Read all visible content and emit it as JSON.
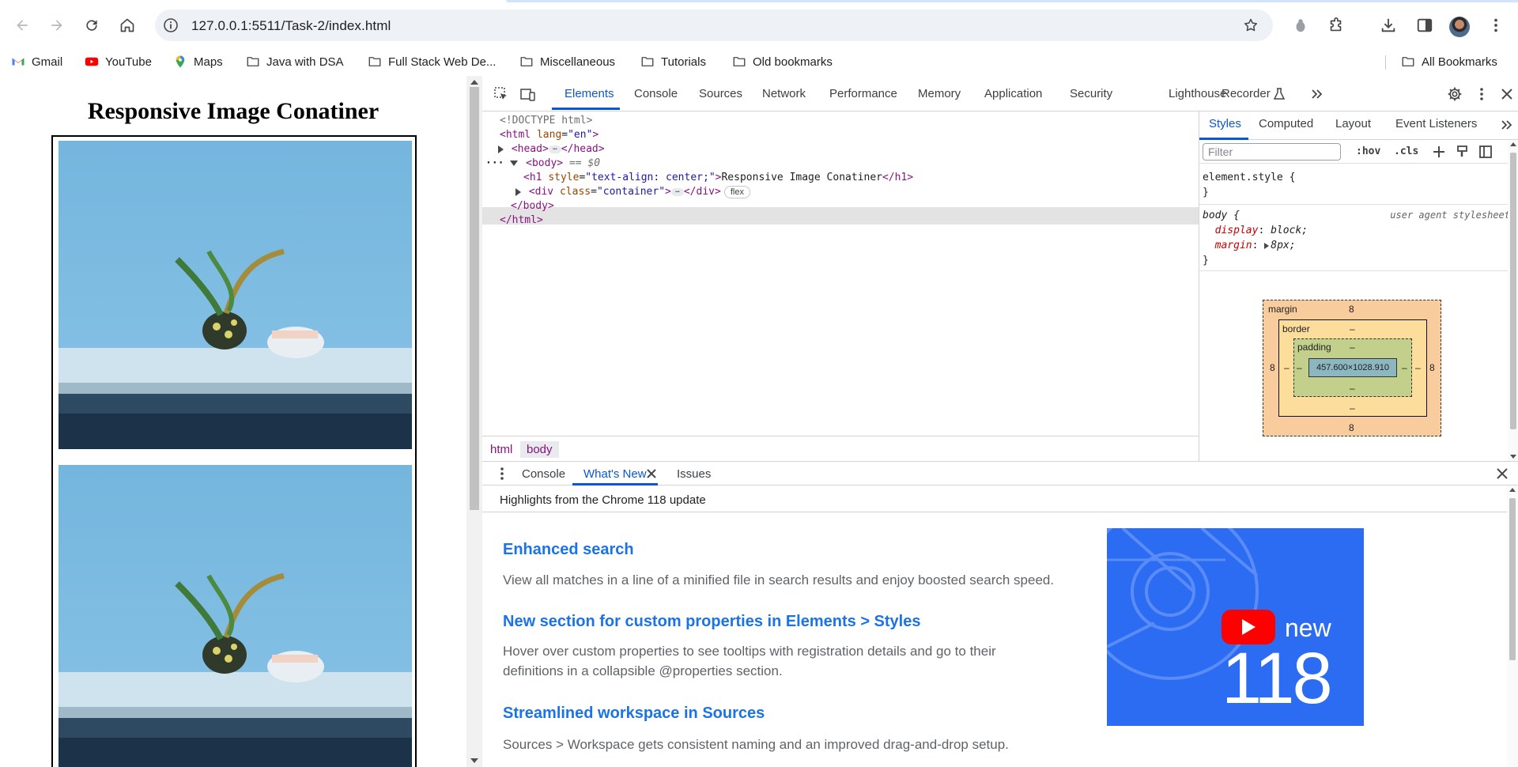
{
  "browser": {
    "url": "127.0.0.1:5511/Task-2/index.html",
    "bookmarks": [
      {
        "label": "Gmail",
        "icon": "gmail-icon"
      },
      {
        "label": "YouTube",
        "icon": "youtube-icon"
      },
      {
        "label": "Maps",
        "icon": "maps-icon"
      },
      {
        "label": "Java with DSA",
        "icon": "folder-icon"
      },
      {
        "label": "Full Stack Web De...",
        "icon": "folder-icon"
      },
      {
        "label": "Miscellaneous",
        "icon": "folder-icon"
      },
      {
        "label": "Tutorials",
        "icon": "folder-icon"
      },
      {
        "label": "Old bookmarks",
        "icon": "folder-icon"
      }
    ],
    "all_bookmarks": "All Bookmarks"
  },
  "page": {
    "heading": "Responsive Image Conatiner"
  },
  "devtools": {
    "tabs": [
      "Elements",
      "Console",
      "Sources",
      "Network",
      "Performance",
      "Memory",
      "Application",
      "Security",
      "Lighthouse",
      "Recorder"
    ],
    "active_tab": "Elements",
    "dom": {
      "doctype": "<!DOCTYPE html>",
      "html_open_tag": "<html",
      "html_attr": "lang",
      "html_val": "\"en\"",
      "head_open": "<head>",
      "head_close": "</head>",
      "body_open": "<body>",
      "body_marker": "== $0",
      "h1_open": "<h1",
      "h1_attr": "style",
      "h1_val": "\"text-align: center;\"",
      "h1_text": "Responsive Image Conatiner",
      "h1_close": "</h1>",
      "div_open": "<div",
      "div_attr": "class",
      "div_val": "\"container\"",
      "div_close": "</div>",
      "flex_badge": "flex",
      "body_close": "</body>",
      "html_close": "</html>"
    },
    "breadcrumbs": [
      "html",
      "body"
    ],
    "styles": {
      "tabs": [
        "Styles",
        "Computed",
        "Layout",
        "Event Listeners"
      ],
      "filter_placeholder": "Filter",
      "hov": ":hov",
      "cls": ".cls",
      "element_style": "element.style {",
      "close_brace": "}",
      "body_selector": "body {",
      "ua_label": "user agent stylesheet",
      "display_prop": "display",
      "display_val": "block;",
      "margin_prop": "margin",
      "margin_val": "8px;"
    },
    "box_model": {
      "margin_label": "margin",
      "border_label": "border",
      "padding_label": "padding",
      "margin": "8",
      "dash": "–",
      "content": "457.600×1028.910"
    },
    "drawer": {
      "tabs": [
        "Console",
        "What's New",
        "Issues"
      ],
      "active_tab": "What's New",
      "header": "Highlights from the Chrome 118 update",
      "items": [
        {
          "title": "Enhanced search",
          "desc": "View all matches in a line of a minified file in search results and enjoy boosted search speed."
        },
        {
          "title": "New section for custom properties in Elements > Styles",
          "desc": "Hover over custom properties to see tooltips with registration details and go to their definitions in a collapsible @properties section."
        },
        {
          "title": "Streamlined workspace in Sources",
          "desc": "Sources > Workspace gets consistent naming and an improved drag-and-drop setup."
        }
      ],
      "video_new": "new",
      "video_version": "118"
    }
  },
  "colors": {
    "accent": "#0b57d0",
    "link": "#1a73e8",
    "margin_box": "#f9cc9d",
    "border_box": "#fddd9b",
    "padding_box": "#c3d08b",
    "content_box": "#8cb6c0"
  }
}
